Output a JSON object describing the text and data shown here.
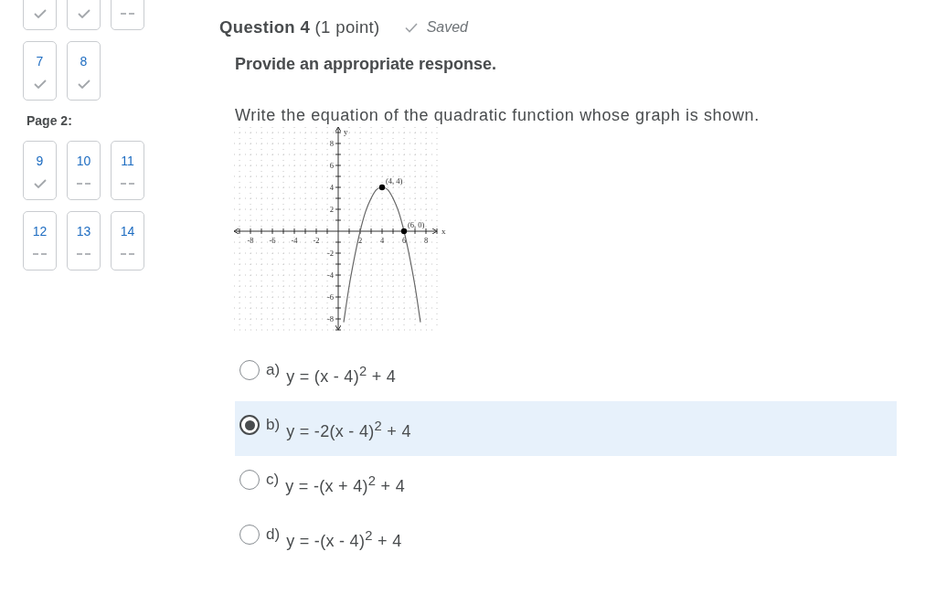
{
  "question_nav": [
    {
      "items": [
        {
          "answered": true
        },
        {
          "answered": true
        },
        {
          "answered": false
        },
        {
          "number": "7",
          "answered": true
        },
        {
          "number": "8",
          "answered": true
        }
      ]
    },
    {
      "label": "Page 2:",
      "items": [
        {
          "number": "9",
          "answered": true
        },
        {
          "number": "10",
          "answered": false
        },
        {
          "number": "11",
          "answered": false
        },
        {
          "number": "12",
          "answered": false
        },
        {
          "number": "13",
          "answered": false
        },
        {
          "number": "14",
          "answered": false
        }
      ]
    }
  ],
  "question": {
    "title": "**Question 4** (1 point)",
    "status": "Saved",
    "instruction": "Provide an appropriate response.",
    "prompt": "Write the equation of the quadratic function whose graph is shown.",
    "chart_data": {
      "type": "line",
      "xlabel": "x",
      "ylabel": "y",
      "x": [
        0.5,
        1,
        1.5,
        2,
        2.5,
        3,
        3.5,
        4,
        4.5,
        5,
        5.5,
        6,
        6.5,
        7,
        7.5
      ],
      "series": [
        {
          "values": [
            -8.3,
            -5,
            -2.3,
            0,
            1.8,
            3,
            3.8,
            4,
            3.8,
            3,
            1.8,
            0,
            -2.3,
            -5,
            -8.3
          ],
          "color": "#666666"
        },
        {
          "type": "scatter",
          "x": [
            4,
            6
          ],
          "values": [
            4,
            0
          ],
          "color": "#000000"
        }
      ],
      "xlim": [
        -9.5,
        9
      ],
      "ylim": [
        -9,
        9.5
      ],
      "xticks": [
        -8,
        -6,
        -4,
        -2,
        2,
        4,
        6,
        8
      ],
      "yticks": [
        -8,
        -6,
        -4,
        -2,
        2,
        4,
        6,
        8
      ],
      "grid": true,
      "annotations": [
        "(4, 4)",
        "(6, 0)"
      ]
    },
    "options": [
      {
        "letter": "a)",
        "text": "y = (x - 4)$^{2}$ + 4",
        "selected": false
      },
      {
        "letter": "b)",
        "text": "y = -2(x - 4)$^{2}$ + 4",
        "selected": true
      },
      {
        "letter": "c)",
        "text": "y = -(x + 4)$^{2}$ + 4",
        "selected": false
      },
      {
        "letter": "d)",
        "text": "y = -(x - 4)$^{2}$ + 4",
        "selected": false
      }
    ]
  }
}
